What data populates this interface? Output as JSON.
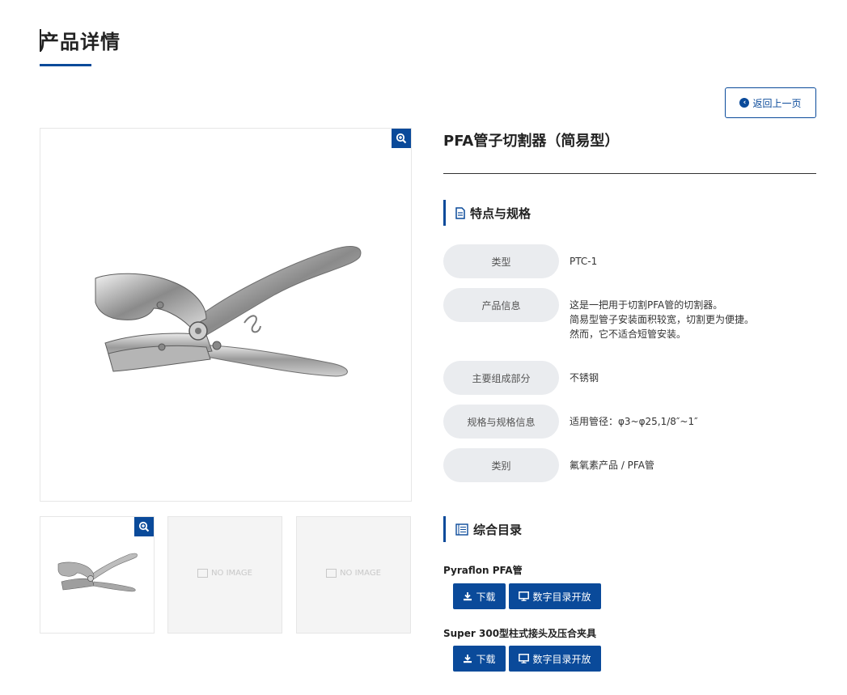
{
  "page": {
    "title": "产品详情"
  },
  "back_button": {
    "label": "返回上一页"
  },
  "gallery": {
    "no_image_text": "NO IMAGE"
  },
  "product": {
    "name": "PFA管子切割器（简易型）"
  },
  "spec_section": {
    "title": "特点与规格",
    "rows": [
      {
        "label": "类型",
        "value": "PTC-1"
      },
      {
        "label": "产品信息",
        "value": [
          "这是一把用于切割PFA管的切割器。",
          "简易型管子安装面积较宽，切割更为便捷。",
          "然而，它不适合短管安装。"
        ]
      },
      {
        "label": "主要组成部分",
        "value": "不锈钢"
      },
      {
        "label": "规格与规格信息",
        "value": "适用管径：φ3~φ25,1/8″~1″"
      },
      {
        "label": "类别",
        "value": "氟氧素产品 / PFA管"
      }
    ]
  },
  "catalog_section": {
    "title": "综合目录",
    "items": [
      {
        "name": "Pyraflon PFA管",
        "download_label": "下载",
        "open_label": "数字目录开放"
      },
      {
        "name": "Super 300型柱式接头及压合夹具",
        "download_label": "下载",
        "open_label": "数字目录开放"
      }
    ]
  },
  "colors": {
    "accent": "#0a4a9a",
    "label_bg": "#eaecef"
  },
  "icons": [
    "zoom-in-icon",
    "arrow-left-circle-icon",
    "document-icon",
    "catalog-icon",
    "download-icon",
    "monitor-icon",
    "image-placeholder-icon"
  ]
}
